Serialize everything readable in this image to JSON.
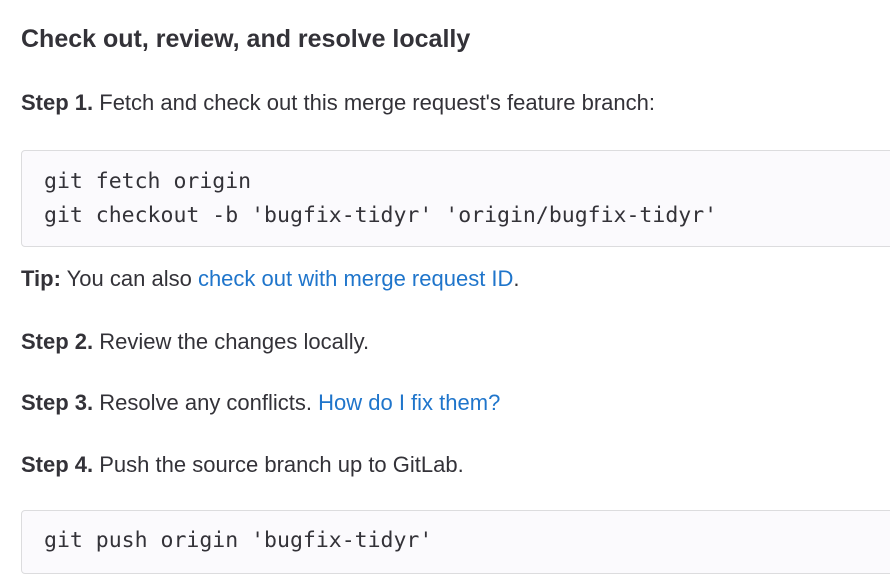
{
  "section": {
    "title": "Check out, review, and resolve locally"
  },
  "step1": {
    "label": "Step 1.",
    "text": " Fetch and check out this merge request's feature branch:"
  },
  "code1": {
    "lines": [
      "git fetch origin",
      "git checkout -b 'bugfix-tidyr' 'origin/bugfix-tidyr'"
    ]
  },
  "tip": {
    "label": "Tip:",
    "text": " You can also ",
    "link": "check out with merge request ID",
    "suffix": "."
  },
  "step2": {
    "label": "Step 2.",
    "text": " Review the changes locally."
  },
  "step3": {
    "label": "Step 3.",
    "text": " Resolve any conflicts. ",
    "link": "How do I fix them?"
  },
  "step4": {
    "label": "Step 4.",
    "text": " Push the source branch up to GitLab."
  },
  "code2": {
    "lines": [
      "git push origin 'bugfix-tidyr'"
    ]
  },
  "colors": {
    "text": "#333238",
    "link": "#1f75cb",
    "code_bg": "#fbfafd",
    "code_border": "#dcdcde"
  }
}
